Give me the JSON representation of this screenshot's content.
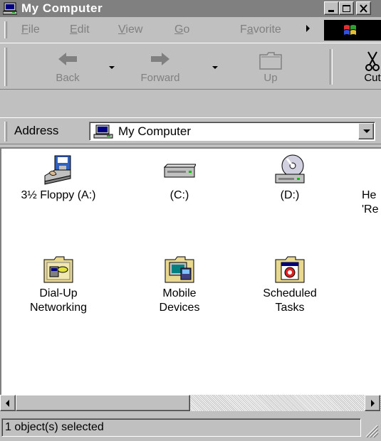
{
  "window": {
    "title": "My Computer"
  },
  "menu": [
    {
      "label": "File",
      "accel": "F",
      "rest": "ile"
    },
    {
      "label": "Edit",
      "accel": "E",
      "rest": "dit"
    },
    {
      "label": "View",
      "accel": "V",
      "rest": "iew"
    },
    {
      "label": "Go",
      "accel": "G",
      "rest": "o"
    },
    {
      "label": "Favorites",
      "pre": "F",
      "accel": "a",
      "rest": "vorite"
    }
  ],
  "toolbar": {
    "back_label": "Back",
    "forward_label": "Forward",
    "up_label": "Up",
    "cut_label": "Cut"
  },
  "address": {
    "label": "Address",
    "value": "My Computer"
  },
  "items": {
    "floppy": "3½ Floppy (A:)",
    "c_drive": "(C:)",
    "d_drive": "(D:)",
    "help": "He\n'Re",
    "dialup": "Dial-Up\nNetworking",
    "mobile": "Mobile\nDevices",
    "tasks": "Scheduled\nTasks"
  },
  "status": {
    "text": "1 object(s) selected"
  },
  "icons": {
    "title": "computer-icon",
    "back": "back-arrow-icon",
    "forward": "forward-arrow-icon",
    "up": "folder-up-icon",
    "cut": "scissors-icon"
  },
  "colors": {
    "title_bar_inactive": "#808080",
    "window_face": "#c0c0c0",
    "content_bg": "#ffffff"
  }
}
